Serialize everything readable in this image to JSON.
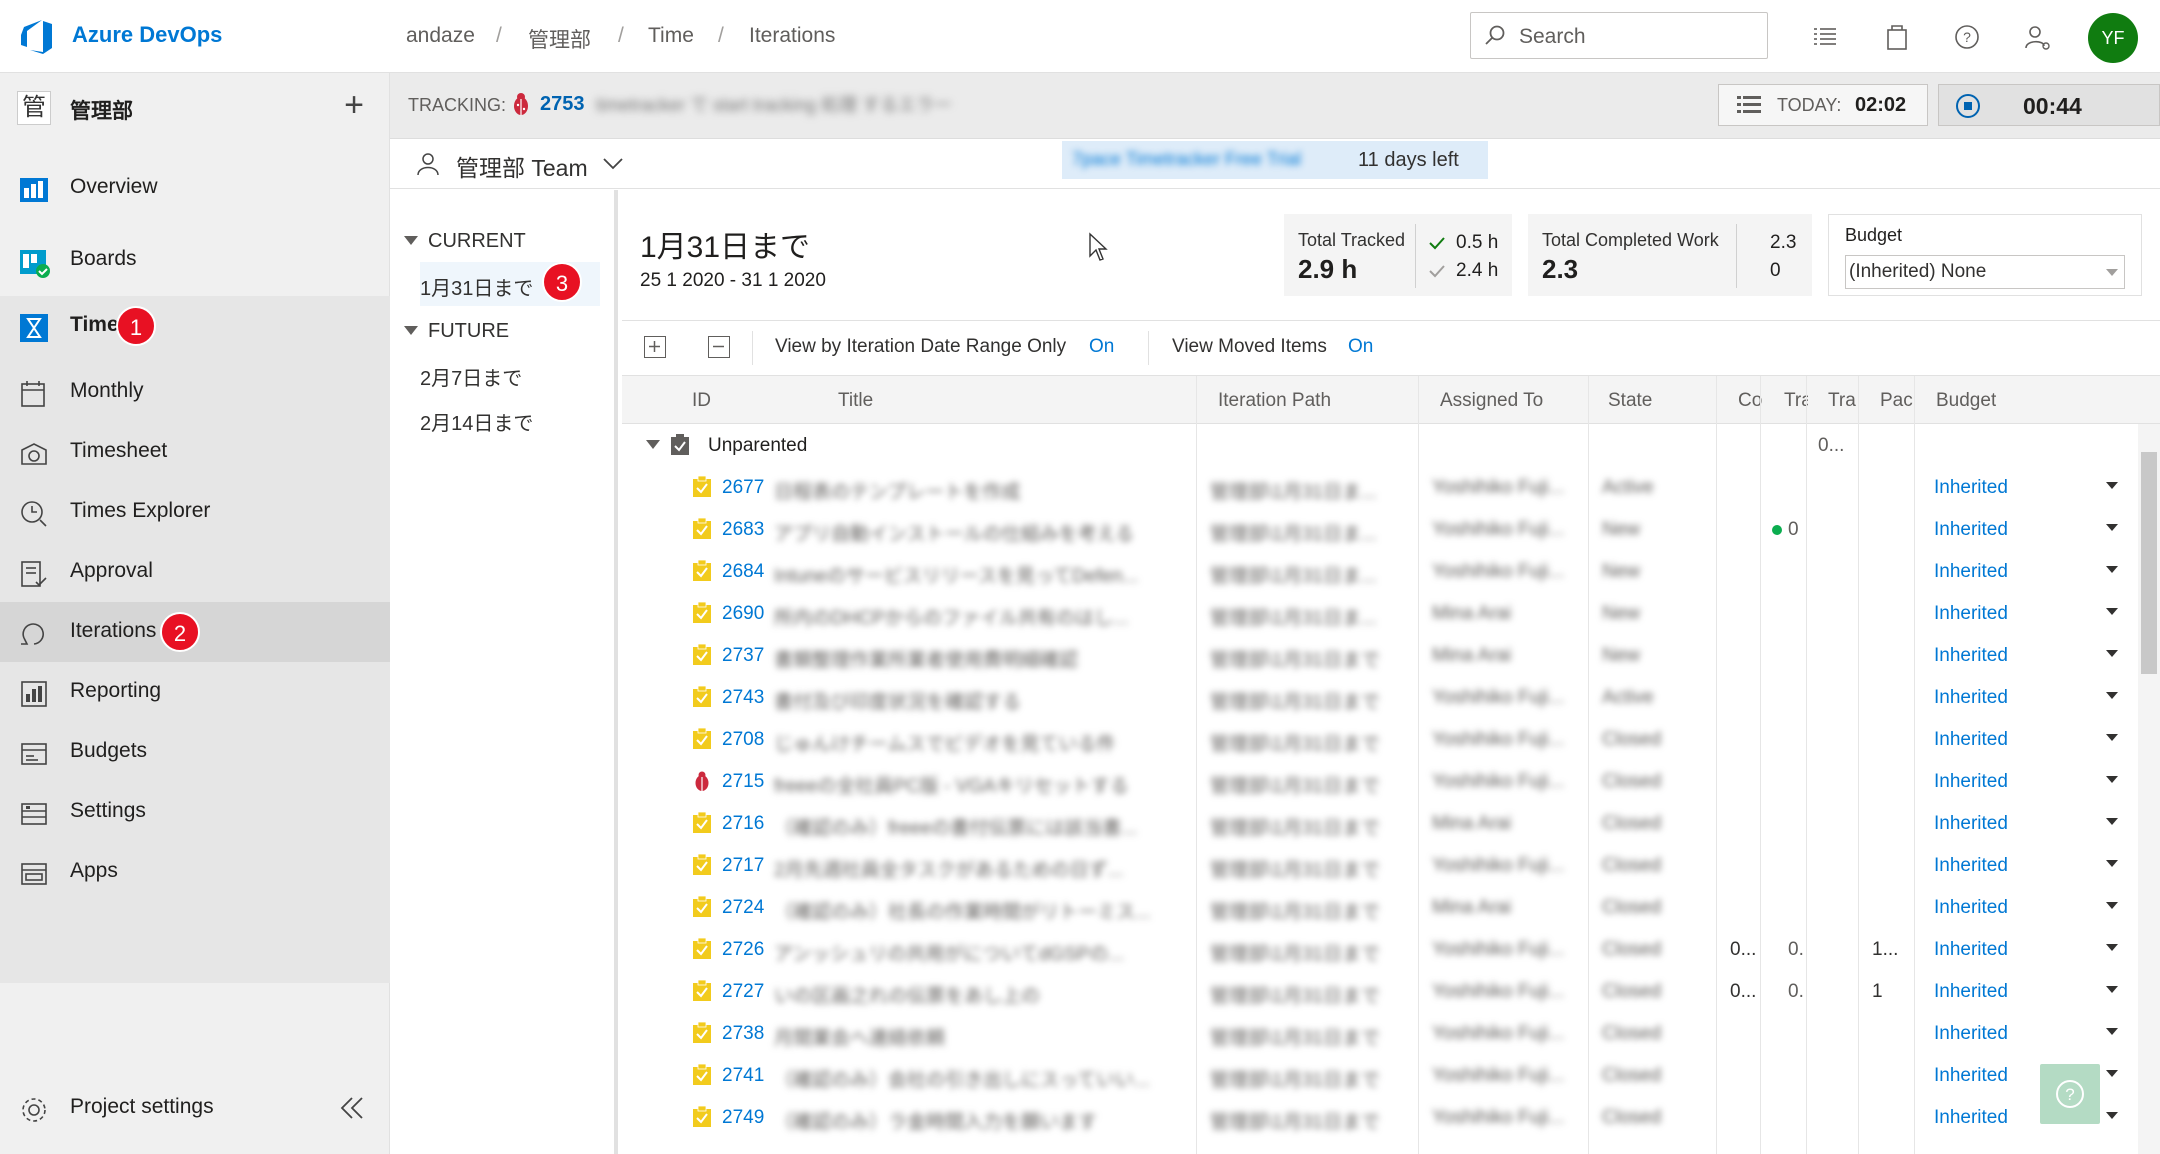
{
  "topbar": {
    "brand": "Azure DevOps",
    "breadcrumb": [
      "andaze",
      "管理部",
      "Time",
      "Iterations"
    ],
    "search_placeholder": "Search",
    "avatar_initials": "YF"
  },
  "sidebar": {
    "project_icon_text": "管",
    "project_name": "管理部",
    "items": [
      {
        "label": "Overview"
      },
      {
        "label": "Boards"
      },
      {
        "label": "Time",
        "badge": "1"
      },
      {
        "label": "Monthly"
      },
      {
        "label": "Timesheet"
      },
      {
        "label": "Times Explorer"
      },
      {
        "label": "Approval"
      },
      {
        "label": "Iterations",
        "badge": "2"
      },
      {
        "label": "Reporting"
      },
      {
        "label": "Budgets"
      },
      {
        "label": "Settings"
      },
      {
        "label": "Apps"
      }
    ],
    "project_settings": "Project settings"
  },
  "tracking": {
    "label": "TRACKING:",
    "work_item_id": "2753",
    "work_item_title": "timetracker で start tracking 処理 するエラー",
    "today_label": "TODAY:",
    "today_value": "02:02",
    "timer_value": "00:44"
  },
  "team": {
    "name": "管理部 Team",
    "trial_text": "7pace Timetracker Free Trial",
    "days_left": "11 days left"
  },
  "iterations": {
    "current_label": "CURRENT",
    "current_items": [
      {
        "label": "1月31日まで",
        "badge": "3"
      }
    ],
    "future_label": "FUTURE",
    "future_items": [
      {
        "label": "2月7日まで"
      },
      {
        "label": "2月14日まで"
      }
    ]
  },
  "summary": {
    "title": "1月31日まで",
    "dates": "25 1 2020 - 31 1 2020",
    "total_tracked_label": "Total Tracked",
    "total_tracked_value": "2.9 h",
    "tracked_approved": "0.5 h",
    "tracked_other": "2.4 h",
    "completed_label": "Total Completed Work",
    "completed_value": "2.3",
    "completed_a": "2.3",
    "completed_b": "0",
    "budget_label": "Budget",
    "budget_value": "(Inherited) None"
  },
  "toolbar": {
    "view_range_label": "View by Iteration Date Range Only",
    "view_range_value": "On",
    "view_moved_label": "View Moved Items",
    "view_moved_value": "On"
  },
  "grid": {
    "columns": [
      "ID",
      "Title",
      "Iteration Path",
      "Assigned To",
      "State",
      "Co",
      "Tra",
      "Tra",
      "Pac",
      "Budget"
    ],
    "group_label": "Unparented",
    "group_tra": "0...",
    "rows": [
      {
        "id": "2677",
        "title": "日程表のテンプレートを作成",
        "path": "管理部\\1月31日ま...",
        "assigned": "Yoshihiko Fuji...",
        "state": "Active",
        "budget": "Inherited"
      },
      {
        "id": "2683",
        "title": "アプリ自動インストールの仕組みを考える",
        "path": "管理部\\1月31日ま...",
        "assigned": "Yoshihiko Fuji...",
        "state": "New",
        "budget": "Inherited",
        "tra": "0"
      },
      {
        "id": "2684",
        "title": "Intuneのサービスリリースを見ってDefen...",
        "path": "管理部\\1月31日ま...",
        "assigned": "Yoshihiko Fuji...",
        "state": "New",
        "budget": "Inherited"
      },
      {
        "id": "2690",
        "title": "所内のDHCPからのファイル共有のはし...",
        "path": "管理部\\1月31日ま...",
        "assigned": "Mina Arai",
        "state": "New",
        "budget": "Inherited"
      },
      {
        "id": "2737",
        "title": "書類整理作業所業者使用費明細確認",
        "path": "管理部\\1月31日まで",
        "assigned": "Mina Arai",
        "state": "New",
        "budget": "Inherited"
      },
      {
        "id": "2743",
        "title": "書付及び印度状況を確認する",
        "path": "管理部\\1月31日まで",
        "assigned": "Yoshihiko Fuji...",
        "state": "Active",
        "budget": "Inherited"
      },
      {
        "id": "2708",
        "title": "じゅんけチームスでビデオを見ている件",
        "path": "管理部\\1月31日まで",
        "assigned": "Yoshihiko Fuji...",
        "state": "Closed",
        "budget": "Inherited"
      },
      {
        "id": "2715",
        "title": "freeeの全社員PC版 - VGAキリセットする",
        "path": "管理部\\1月31日まで",
        "assigned": "Yoshihiko Fuji...",
        "state": "Closed",
        "budget": "Inherited",
        "bug": true
      },
      {
        "id": "2716",
        "title": "（確認のみ）freeeの書付伝票には該当書...",
        "path": "管理部\\1月31日まで",
        "assigned": "Mina Arai",
        "state": "Closed",
        "budget": "Inherited"
      },
      {
        "id": "2717",
        "title": "2月先週社員全タスクがあるための日ず...",
        "path": "管理部\\1月31日まで",
        "assigned": "Yoshihiko Fuji...",
        "state": "Closed",
        "budget": "Inherited"
      },
      {
        "id": "2724",
        "title": "（確認のみ）社長の作業時間がリトーミス...",
        "path": "管理部\\1月31日まで",
        "assigned": "Mina Arai",
        "state": "Closed",
        "budget": "Inherited"
      },
      {
        "id": "2726",
        "title": "アンッシュリの共用がについてdGSPの...",
        "path": "管理部\\1月31日まで",
        "assigned": "Yoshihiko Fuji...",
        "state": "Closed",
        "budget": "Inherited",
        "co": "0...",
        "tra": "0.",
        "pac": "1..."
      },
      {
        "id": "2727",
        "title": "いの区画之れの伝票をあし上の",
        "path": "管理部\\1月31日まで",
        "assigned": "Yoshihiko Fuji...",
        "state": "Closed",
        "budget": "Inherited",
        "co": "0...",
        "tra": "0.",
        "pac": "1"
      },
      {
        "id": "2738",
        "title": "月間業会へ連絡依頼",
        "path": "管理部\\1月31日まで",
        "assigned": "Yoshihiko Fuji...",
        "state": "Closed",
        "budget": "Inherited"
      },
      {
        "id": "2741",
        "title": "（確認のみ）会社の引き出しにスっていい...",
        "path": "管理部\\1月31日まで",
        "assigned": "Yoshihiko Fuji...",
        "state": "Closed",
        "budget": "Inherited"
      },
      {
        "id": "2749",
        "title": "（確認のみ）ラ金時間入力を願います",
        "path": "管理部\\1月31日まで",
        "assigned": "Yoshihiko Fuji...",
        "state": "Closed",
        "budget": "Inherited"
      }
    ]
  }
}
